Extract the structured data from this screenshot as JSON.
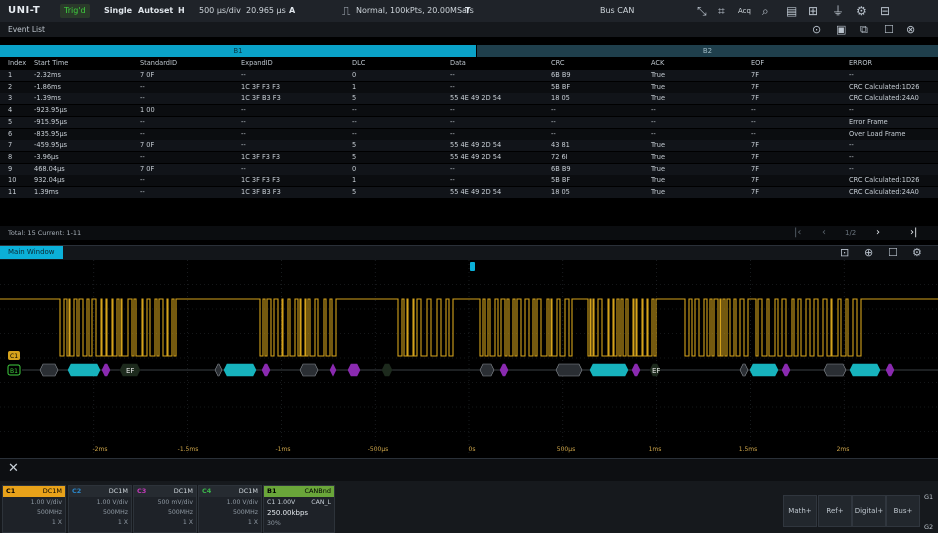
{
  "topbar": {
    "brand": "UNI-T",
    "trigger_status": "Trig'd",
    "single_label": "Single",
    "autoset_label": "Autoset",
    "h_label": "H",
    "timebase": "500 µs/div",
    "h_position": "20.965 µs",
    "a_label": "A",
    "acq_info": "Normal, 100kPts, 20.00MSa/s",
    "t_label": "T",
    "bus_label": "Bus CAN",
    "acq_label": "Acq"
  },
  "event_list": {
    "title": "Event List",
    "segments": [
      "B1",
      "B2"
    ],
    "columns": [
      "Index",
      "Start Time",
      "StandardID",
      "ExpandID",
      "DLC",
      "Data",
      "CRC",
      "ACK",
      "EOF",
      "ERROR"
    ],
    "rows": [
      [
        "1",
        "-2.32ms",
        "7 0F",
        "--",
        "0",
        "--",
        "6B B9",
        "True",
        "7F",
        "--"
      ],
      [
        "2",
        "-1.86ms",
        "--",
        "1C 3F F3 F3",
        "1",
        "--",
        "5B BF",
        "True",
        "7F",
        "CRC Calculated:1D26"
      ],
      [
        "3",
        "-1.39ms",
        "--",
        "1C 3F B3 F3",
        "5",
        "55 4E 49 2D 54",
        "18 05",
        "True",
        "7F",
        "CRC Calculated:24A0"
      ],
      [
        "4",
        "-923.95µs",
        "1 00",
        "--",
        "--",
        "--",
        "--",
        "--",
        "--",
        "--"
      ],
      [
        "5",
        "-915.95µs",
        "--",
        "--",
        "--",
        "--",
        "--",
        "--",
        "--",
        "Error Frame"
      ],
      [
        "6",
        "-835.95µs",
        "--",
        "--",
        "--",
        "--",
        "--",
        "--",
        "--",
        "Over Load Frame"
      ],
      [
        "7",
        "-459.95µs",
        "7 0F",
        "--",
        "5",
        "55 4E 49 2D 54",
        "43 81",
        "True",
        "7F",
        "--"
      ],
      [
        "8",
        "-3.96µs",
        "--",
        "1C 3F F3 F3",
        "5",
        "55 4E 49 2D 54",
        "72 6I",
        "True",
        "7F",
        "--"
      ],
      [
        "9",
        "468.04µs",
        "7 0F",
        "--",
        "0",
        "--",
        "6B B9",
        "True",
        "7F",
        "--"
      ],
      [
        "10",
        "932.04µs",
        "--",
        "1C 3F F3 F3",
        "1",
        "--",
        "5B BF",
        "True",
        "7F",
        "CRC Calculated:1D26"
      ],
      [
        "11",
        "1.39ms",
        "--",
        "1C 3F B3 F3",
        "5",
        "55 4E 49 2D 54",
        "18 05",
        "True",
        "7F",
        "CRC Calculated:24A0"
      ]
    ],
    "footer": "Total: 15  Current: 1-11",
    "page_indicator": "1/2"
  },
  "main_window": {
    "label": "Main Window",
    "time_ticks": [
      "-2ms",
      "-1.5ms",
      "-1ms",
      "-500µs",
      "0s",
      "500µs",
      "1ms",
      "1.5ms",
      "2ms"
    ],
    "bus_labels": [
      "EF",
      "EF"
    ],
    "c1_marker": "C1",
    "b1_marker": "B1"
  },
  "channels": [
    {
      "name": "C1",
      "coupling": "DC1M",
      "scale": "1.00 V/div",
      "bw": "500MHz",
      "probe": "1 X",
      "color": "#e8a21a"
    },
    {
      "name": "C2",
      "coupling": "DC1M",
      "scale": "1.00 V/div",
      "bw": "500MHz",
      "probe": "1 X",
      "color": "#2a86c8"
    },
    {
      "name": "C3",
      "coupling": "DC1M",
      "scale": "500 mV/div",
      "bw": "500MHz",
      "probe": "1 X",
      "color": "#c23ab8"
    },
    {
      "name": "C4",
      "coupling": "DC1M",
      "scale": "1.00 V/div",
      "bw": "500MHz",
      "probe": "1 X",
      "color": "#3bb54a"
    }
  ],
  "bus_panel": {
    "name": "B1",
    "type": "CANBnd",
    "source": "C1 1.00V",
    "signal": "CAN_L",
    "rate": "250.00kbps",
    "extra": "30%"
  },
  "right_buttons": [
    "Math+",
    "Ref+",
    "Digital+",
    "Bus+"
  ],
  "g_labels": [
    "G1",
    "G2"
  ],
  "colors": {
    "trace": "#d4a21c",
    "accent": "#0bb0d8",
    "bus_data": "#17b3bd",
    "bus_ctrl": "#8a2ab0"
  }
}
